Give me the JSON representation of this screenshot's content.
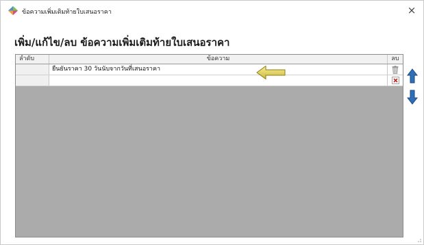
{
  "window": {
    "title": "ข้อความเพิ่มเติมท้ายใบเสนอราคา",
    "close_glyph": "×",
    "app_icon": "diamond-app-icon"
  },
  "page": {
    "heading": "เพิ่ม/แก้ไข/ลบ ข้อความเพิ่มเติมท้ายใบเสนอราคา"
  },
  "grid": {
    "columns": {
      "seq": "ลำดับ",
      "message": "ข้อความ",
      "delete": "ลบ"
    },
    "rows": [
      {
        "seq": "",
        "message": "ยืนยันราคา 30 วันนับจากวันที่เสนอราคา",
        "delete_icon": "trash-icon"
      },
      {
        "seq": "",
        "message": "",
        "delete_icon": "delete-x-icon"
      }
    ]
  },
  "icons": {
    "move_up": "arrow-up-icon",
    "move_down": "arrow-down-icon",
    "pointer": "yellow-arrow-pointer-icon"
  },
  "colors": {
    "grid_background": "#ababab",
    "arrow_blue": "#2e6fb8",
    "pointer_yellow": "#e8d86a",
    "delete_red": "#d02020"
  }
}
